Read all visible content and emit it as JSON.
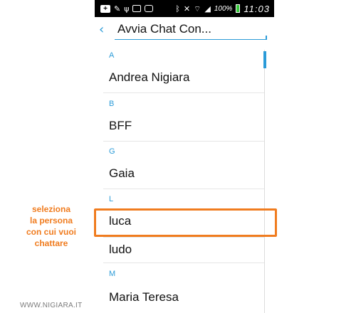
{
  "statusbar": {
    "left_icons": [
      "plus-icon",
      "wrench-icon",
      "usb-icon",
      "image-icon",
      "instagram-icon"
    ],
    "right_icons": [
      "bluetooth-icon",
      "mute-icon",
      "wifi-icon",
      "signal-icon"
    ],
    "battery_percent": "100%",
    "time": "11:03",
    "battery_color": "#35c93a"
  },
  "header": {
    "back_icon": "chevron-left-icon",
    "search_value": "Avvia Chat Con..."
  },
  "contacts": {
    "sections": [
      {
        "letter": "A",
        "names": [
          "Andrea Nigiara"
        ]
      },
      {
        "letter": "B",
        "names": [
          "BFF"
        ]
      },
      {
        "letter": "G",
        "names": [
          "Gaia"
        ]
      },
      {
        "letter": "L",
        "names": [
          "luca",
          "ludo"
        ]
      },
      {
        "letter": "M",
        "names": [
          "Maria Teresa"
        ]
      }
    ]
  },
  "annotation": {
    "lines": [
      "seleziona",
      "la persona",
      "con cui vuoi",
      "chattare"
    ],
    "color": "#f07c1f"
  },
  "watermark": "WWW.NIGIARA.IT",
  "colors": {
    "accent": "#2b9bd8",
    "highlight": "#f07c1f",
    "statusbar": "#000000"
  }
}
